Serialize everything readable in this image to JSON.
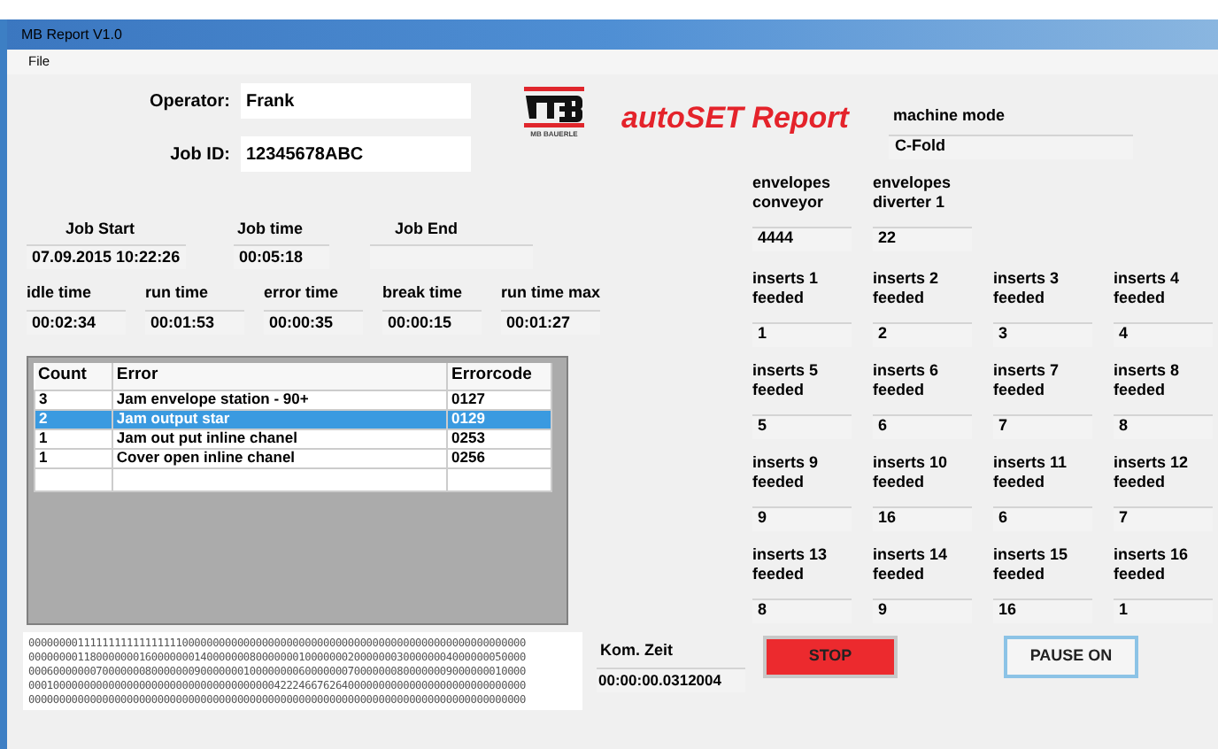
{
  "window": {
    "title": "MB Report V1.0"
  },
  "menu": [
    "File"
  ],
  "operator": {
    "label": "Operator:",
    "value": "Frank"
  },
  "job_id": {
    "label": "Job ID:",
    "value": "12345678ABC"
  },
  "logo_caption": "MB BAUERLE",
  "heading": "autoSET Report",
  "machine_mode": {
    "label": "machine mode",
    "value": "C-Fold"
  },
  "job_times": [
    {
      "label": "Job Start",
      "value": "07.09.2015 10:22:26"
    },
    {
      "label": "Job time",
      "value": "00:05:18"
    },
    {
      "label": "Job End"
    }
  ],
  "durations": [
    {
      "label": "idle time",
      "value": "00:02:34"
    },
    {
      "label": "run time",
      "value": "00:01:53"
    },
    {
      "label": "error time",
      "value": "00:00:35"
    },
    {
      "label": "break time",
      "value": "00:00:15"
    },
    {
      "label": "run time max",
      "value": "00:01:27"
    }
  ],
  "error_table": {
    "columns": [
      "Count",
      "Error",
      "Errorcode"
    ],
    "rows": [
      {
        "cells": [
          "3",
          "Jam envelope station - 90+",
          "0127"
        ],
        "selected": false
      },
      {
        "cells": [
          "2",
          "Jam output star",
          "0129"
        ],
        "selected": true
      },
      {
        "cells": [
          "1",
          "Jam out put inline chanel",
          "0253"
        ],
        "selected": false
      },
      {
        "cells": [
          "1",
          "Cover open inline chanel",
          "0256"
        ],
        "selected": false
      }
    ]
  },
  "log_lines": [
    "000000001111111111111111100000000000000000000000000000000000000000000000000000000",
    "000000001180000000160000000140000000800000001000000020000000300000004000000050000",
    "000600000007000000080000000900000001000000006000000070000000800000009000000010000",
    "000100000000000000000000000000000000000042224667626400000000000000000000000000000",
    "000000000000000000000000000000000000000000000000000000000000000000000000000000000"
  ],
  "envelopes": [
    {
      "label": "envelopes conveyor",
      "value": "4444"
    },
    {
      "label": "envelopes diverter 1",
      "value": "22"
    }
  ],
  "inserts": [
    {
      "label": "inserts 1 feeded",
      "value": "1"
    },
    {
      "label": "inserts 2 feeded",
      "value": "2"
    },
    {
      "label": "inserts 3 feeded",
      "value": "3"
    },
    {
      "label": "inserts 4 feeded",
      "value": "4"
    },
    {
      "label": "inserts 5 feeded",
      "value": "5"
    },
    {
      "label": "inserts 6 feeded",
      "value": "6"
    },
    {
      "label": "inserts 7 feeded",
      "value": "7"
    },
    {
      "label": "inserts 8 feeded",
      "value": "8"
    },
    {
      "label": "inserts 9 feeded",
      "value": "9"
    },
    {
      "label": "inserts 10 feeded",
      "value": "16"
    },
    {
      "label": "inserts 11 feeded",
      "value": "6"
    },
    {
      "label": "inserts 12 feeded",
      "value": "7"
    },
    {
      "label": "inserts 13 feeded",
      "value": "8"
    },
    {
      "label": "inserts 14 feeded",
      "value": "9"
    },
    {
      "label": "inserts 15 feeded",
      "value": "16"
    },
    {
      "label": "inserts 16 feeded",
      "value": "1"
    }
  ],
  "kom_zeit": {
    "label": "Kom. Zeit",
    "value": "00:00:00.0312004"
  },
  "buttons": [
    {
      "label": "STOP",
      "kind": "stop"
    },
    {
      "label": "PAUSE ON",
      "kind": "pause"
    }
  ]
}
